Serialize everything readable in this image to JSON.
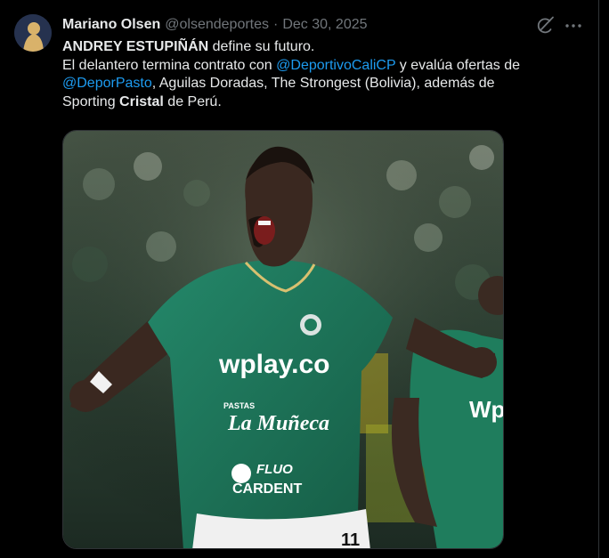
{
  "tweet": {
    "author_name": "Mariano Olsen",
    "handle": "@olsendeportes",
    "separator": "·",
    "date": "Dec 30, 2025",
    "text": {
      "line1_bold": "ANDREY ESTUPIÑÁN",
      "line1_rest": " define su futuro.",
      "line2_pre": "El delantero termina contrato con ",
      "mention1": "@DeportivoCaliCP",
      "line2_post": " y evalúa ofertas de",
      "mention2": "@DeporPasto",
      "line3_post": ", Aguilas Doradas, The Strongest (Bolivia), además de",
      "line4_pre": "Sporting ",
      "line4_bold": "Cristal",
      "line4_post": " de Perú."
    },
    "icons": {
      "grok": "grok-icon",
      "more": "more-icon"
    }
  },
  "media": {
    "jersey": {
      "sponsor_main": "wplay.co",
      "sponsor_pastas_small": "PASTAS",
      "sponsor_pastas": "La Muñeca",
      "sponsor_fluo_top": "FLUO",
      "sponsor_fluo_bottom": "CARDENT",
      "number": "11",
      "second_player_sponsor": "Wp"
    }
  },
  "colors": {
    "background": "#000000",
    "text": "#e7e9ea",
    "muted": "#71767b",
    "link": "#1d9bf0",
    "jersey": "#1e7a5b"
  }
}
